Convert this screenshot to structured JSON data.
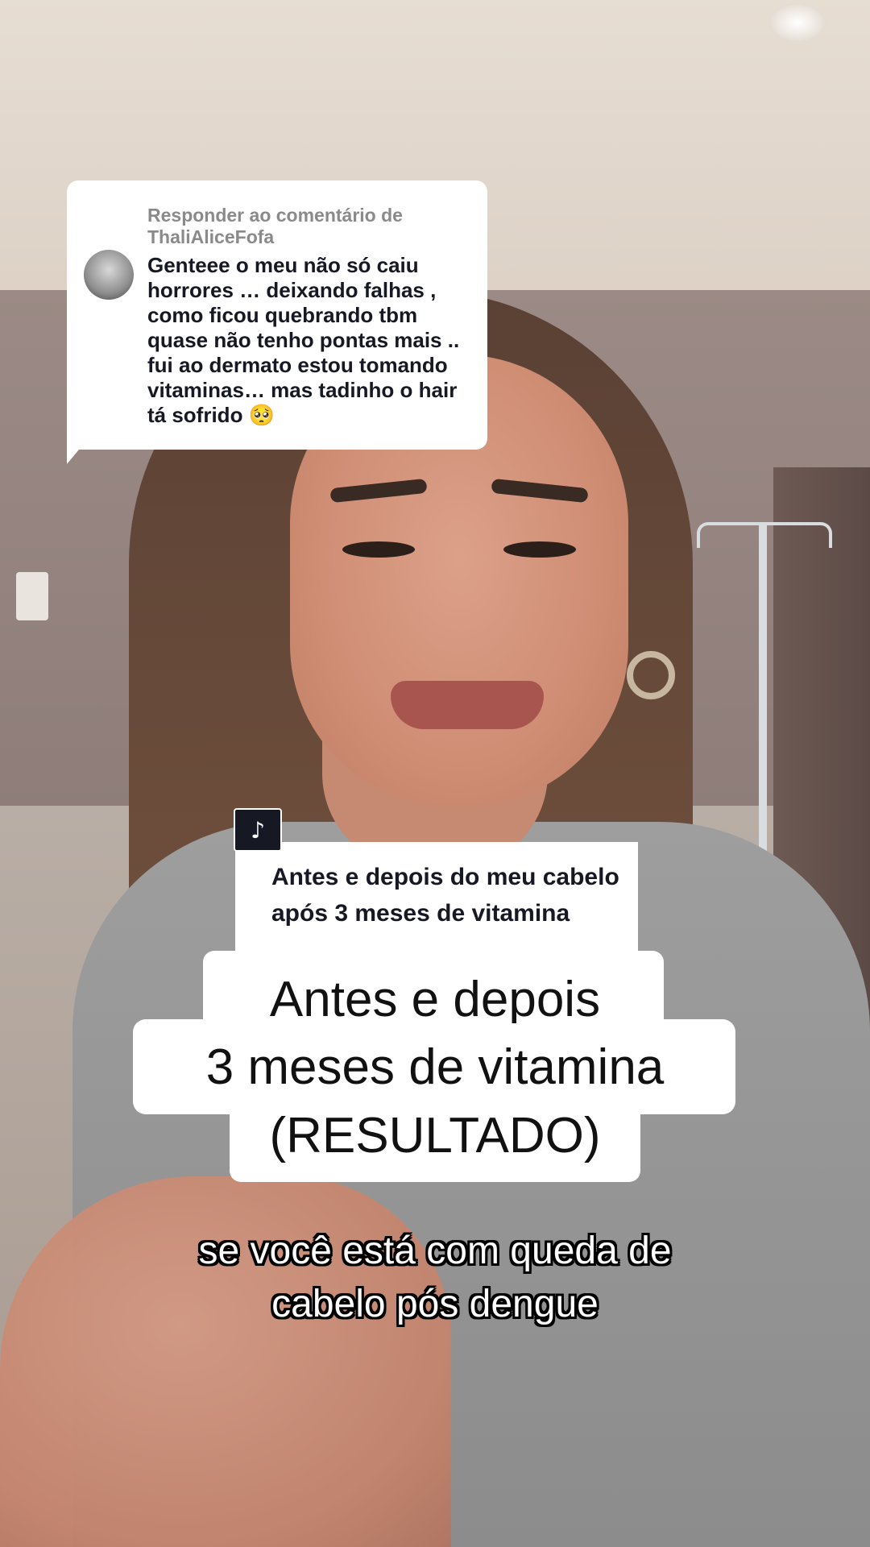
{
  "reply": {
    "header": "Responder ao comentário de ThaliAliceFofa",
    "text": "Genteee o meu não só caiu horrores … deixando falhas , como ficou quebrando tbm quase não tenho pontas mais .. fui ao dermato estou tomando vitaminas… mas tadinho o hair tá sofrido 🥺"
  },
  "caption": {
    "logo_glyph": "♪",
    "text": "Antes e depois do meu cabelo após 3 meses de vitamina"
  },
  "title": {
    "line1": "Antes e depois",
    "line2": "3 meses de vitamina",
    "line3": "(RESULTADO)"
  },
  "subtitle": {
    "line1": "se você está com queda de",
    "line2": "cabelo pós dengue"
  }
}
